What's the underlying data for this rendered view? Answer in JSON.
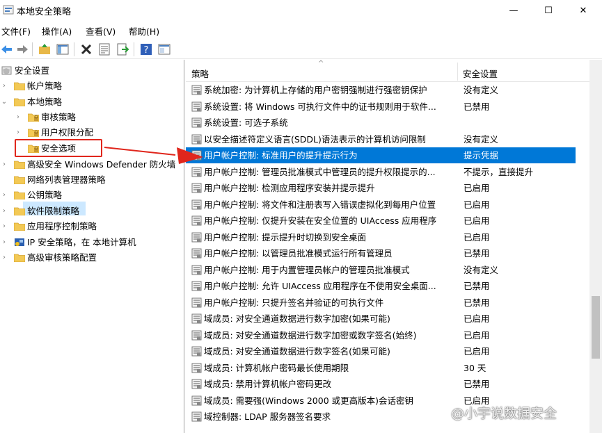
{
  "window": {
    "title": "本地安全策略",
    "minimize": "—",
    "maximize": "☐",
    "close": "✕"
  },
  "menu": [
    "文件(F)",
    "操作(A)",
    "查看(V)",
    "帮助(H)"
  ],
  "toolbar_icons": [
    "back-icon",
    "forward-icon",
    "up-folder-icon",
    "show-tree-icon",
    "delete-icon",
    "properties-icon",
    "export-icon",
    "help-icon",
    "console-icon"
  ],
  "tree": [
    {
      "label": "安全设置",
      "icon": "shield-icon"
    },
    {
      "label": "帐户策略",
      "icon": "folder-icon",
      "chevron": "›"
    },
    {
      "label": "本地策略",
      "icon": "folder-icon",
      "chevron": "⌄"
    },
    {
      "label": "审核策略",
      "icon": "folder-icon",
      "chevron": "›"
    },
    {
      "label": "用户权限分配",
      "icon": "folder-icon",
      "chevron": "›"
    },
    {
      "label": "安全选项",
      "icon": "folder-icon"
    },
    {
      "label": "高级安全 Windows Defender 防火墙",
      "icon": "folder-icon",
      "chevron": "›"
    },
    {
      "label": "网络列表管理器策略",
      "icon": "folder-icon"
    },
    {
      "label": "公钥策略",
      "icon": "folder-icon",
      "chevron": "›"
    },
    {
      "label": "软件限制策略",
      "icon": "folder-icon",
      "chevron": "›"
    },
    {
      "label": "应用程序控制策略",
      "icon": "folder-icon",
      "chevron": "›"
    },
    {
      "label": "IP 安全策略，在 本地计算机",
      "icon": "ip-security-icon",
      "chevron": "›"
    },
    {
      "label": "高级审核策略配置",
      "icon": "folder-icon",
      "chevron": "›"
    }
  ],
  "list": {
    "columns": [
      "策略",
      "安全设置"
    ],
    "sort_indicator": "^",
    "rows": [
      [
        "系统加密: 为计算机上存储的用户密钥强制进行强密钥保护",
        "没有定义"
      ],
      [
        "系统设置: 将 Windows 可执行文件中的证书规则用于软件...",
        "已禁用"
      ],
      [
        "系统设置: 可选子系统",
        ""
      ],
      [
        "以安全描述符定义语言(SDDL)语法表示的计算机访问限制",
        "没有定义"
      ],
      [
        "用户帐户控制: 标准用户的提升提示行为",
        "提示凭据"
      ],
      [
        "用户帐户控制: 管理员批准模式中管理员的提升权限提示的...",
        "不提示，直接提升"
      ],
      [
        "用户帐户控制: 检测应用程序安装并提示提升",
        "已启用"
      ],
      [
        "用户帐户控制: 将文件和注册表写入错误虚拟化到每用户位置",
        "已启用"
      ],
      [
        "用户帐户控制: 仅提升安装在安全位置的 UIAccess 应用程序",
        "已启用"
      ],
      [
        "用户帐户控制: 提示提升时切换到安全桌面",
        "已启用"
      ],
      [
        "用户帐户控制: 以管理员批准模式运行所有管理员",
        "已禁用"
      ],
      [
        "用户帐户控制: 用于内置管理员帐户的管理员批准模式",
        "没有定义"
      ],
      [
        "用户帐户控制: 允许 UIAccess 应用程序在不使用安全桌面...",
        "已禁用"
      ],
      [
        "用户帐户控制: 只提升签名并验证的可执行文件",
        "已禁用"
      ],
      [
        "域成员: 对安全通道数据进行数字加密(如果可能)",
        "已启用"
      ],
      [
        "域成员: 对安全通道数据进行数字加密或数字签名(始终)",
        "已启用"
      ],
      [
        "域成员: 对安全通道数据进行数字签名(如果可能)",
        "已启用"
      ],
      [
        "域成员: 计算机帐户密码最长使用期限",
        "30 天"
      ],
      [
        "域成员: 禁用计算机帐户密码更改",
        "已禁用"
      ],
      [
        "域成员: 需要强(Windows 2000 或更高版本)会话密钥",
        "已启用"
      ],
      [
        "域控制器: LDAP 服务器签名要求",
        ""
      ]
    ],
    "selected_index": 4
  },
  "watermark": "@小宇说数据安全",
  "colors": {
    "selection": "#0078d7",
    "tree_selection": "#cce8ff",
    "annotation": "#e0261c"
  }
}
